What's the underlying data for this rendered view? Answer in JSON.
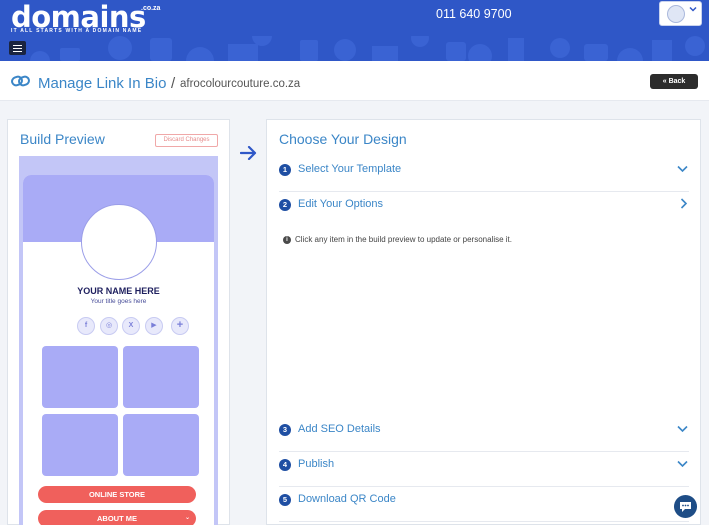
{
  "header": {
    "logo": "domains",
    "logo_suffix": ".co.za",
    "tagline": "IT ALL STARTS WITH A DOMAIN NAME",
    "phone": "011 640 9700",
    "menu_icon": "hamburger-icon",
    "user_icon": "user-avatar-icon"
  },
  "titlebar": {
    "title": "Manage Link In Bio",
    "separator": "/",
    "domain": "afrocolourcouture.co.za",
    "back_label": "Back"
  },
  "build_preview": {
    "title": "Build Preview",
    "discard_label": "Discard Changes",
    "name": "YOUR NAME HERE",
    "subtitle": "Your title goes here",
    "social_icons": [
      "facebook-icon",
      "instagram-icon",
      "x-icon",
      "youtube-icon",
      "add-icon"
    ],
    "buttons": [
      "ONLINE STORE",
      "ABOUT ME"
    ]
  },
  "design": {
    "title": "Choose Your Design",
    "steps": [
      {
        "num": "1",
        "label": "Select Your Template"
      },
      {
        "num": "2",
        "label": "Edit Your Options"
      },
      {
        "num": "3",
        "label": "Add SEO Details"
      },
      {
        "num": "4",
        "label": "Publish"
      },
      {
        "num": "5",
        "label": "Download QR Code"
      }
    ],
    "info_text": "Click any item in the build preview to update or personalise it."
  },
  "colors": {
    "brand_blue": "#2f57c7",
    "accent_blue": "#3b86c7",
    "preview_purple": "#a9abf6",
    "pill_red": "#f0605c"
  }
}
